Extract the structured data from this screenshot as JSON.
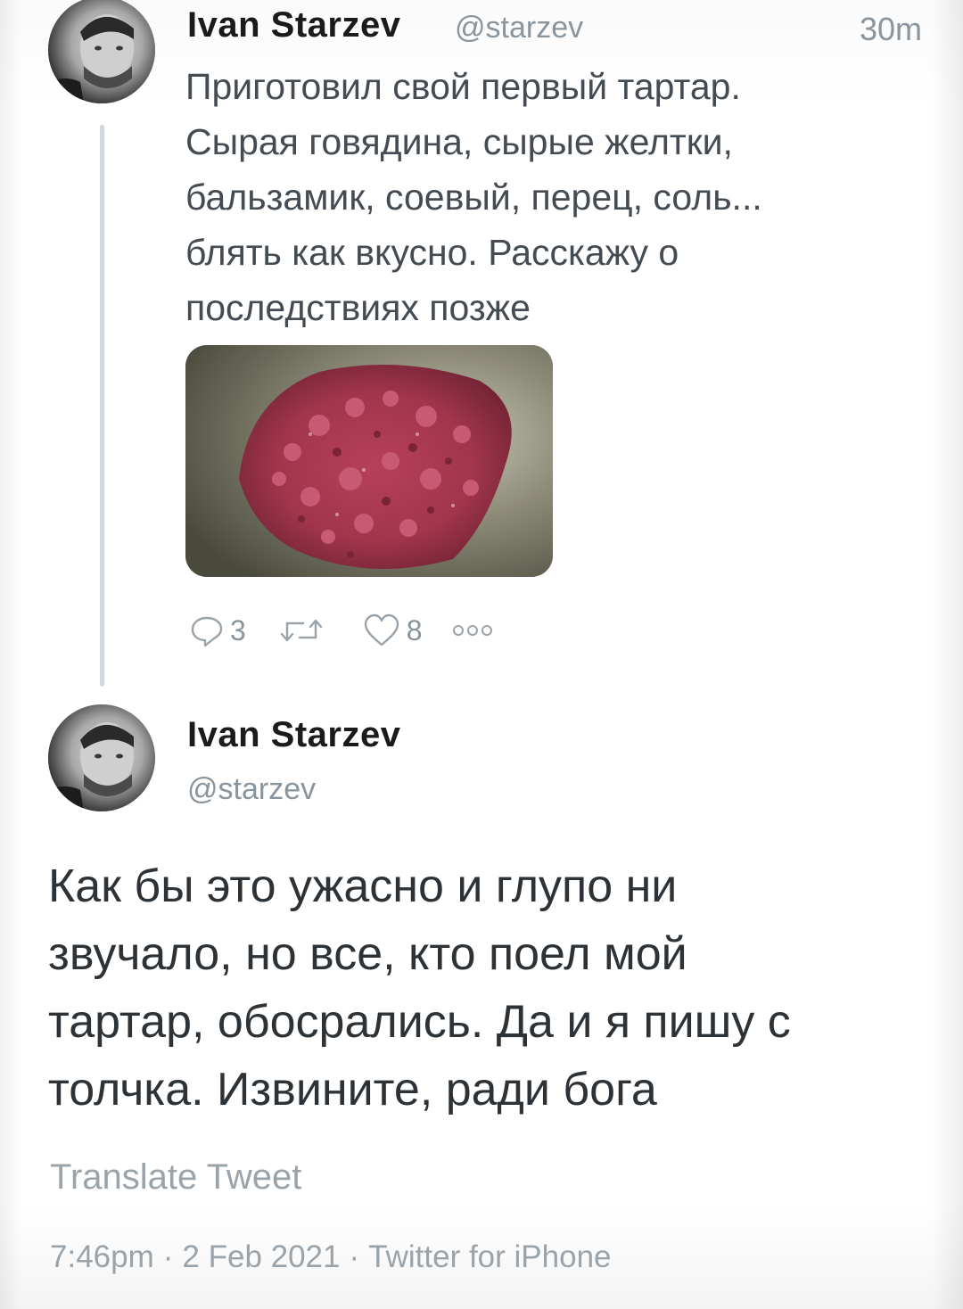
{
  "tweet_1": {
    "author_name": "Ivan Starzev",
    "author_handle": "@starzev",
    "time": "30m",
    "text_lines": [
      "Приготовил свой первый тартар.",
      "Сырая говядина, сырые желтки,",
      "бальзамик, соевый, перец, соль...",
      "блять как вкусно. Расскажу о",
      "последствиях позже"
    ],
    "actions": {
      "reply_icon": "reply-icon",
      "reply_count": "3",
      "retweet_icon": "retweet-icon",
      "like_icon": "heart-icon",
      "like_count": "8",
      "more_icon": "more-dots-icon"
    }
  },
  "tweet_2": {
    "author_name": "Ivan Starzev",
    "author_handle": "@starzev",
    "text_lines": [
      "Как бы это ужасно и глупо ни",
      "звучало, но все, кто поел мой",
      "тартар, обосрались. Да и я пишу с",
      "толчка. Извините, ради бога"
    ],
    "translate_label": "Translate Tweet",
    "meta": {
      "time": "7:46pm",
      "date": "2 Feb 2021",
      "source": "Twitter for iPhone",
      "separator": "·"
    }
  },
  "colors": {
    "text_dark": "#14171a",
    "text_muted": "#8a949c",
    "thread_line": "#cfd9de"
  }
}
